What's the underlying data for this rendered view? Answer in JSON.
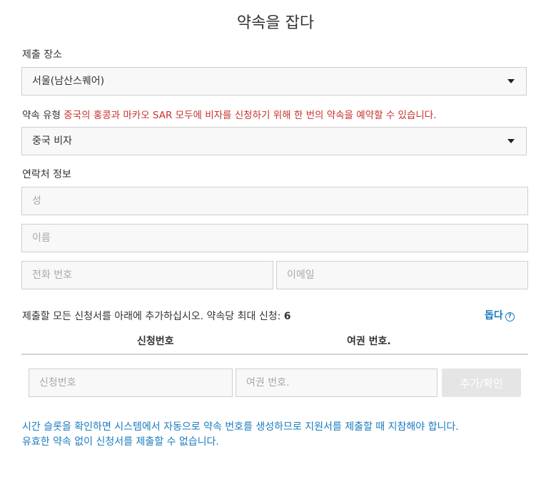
{
  "page_title": "약속을 잡다",
  "location": {
    "label": "제출 장소",
    "selected": "서울(남산스퀘어)"
  },
  "appointment_type": {
    "label": "약속 유형",
    "notice": "중국의 홍콩과 마카오 SAR 모두에 비자를 신청하기 위해 한 번의 약속을 예약할 수 있습니다.",
    "selected": "중국 비자"
  },
  "contact": {
    "label": "연락처 정보",
    "last_name_placeholder": "성",
    "first_name_placeholder": "이름",
    "phone_placeholder": "전화 번호",
    "email_placeholder": "이메일"
  },
  "applications": {
    "instruction": "제출할 모든 신청서를 아래에 추가하십시오. 약속당 최대 신청: ",
    "max_count": "6",
    "help_label": "돕다",
    "help_icon": "question-circle-icon",
    "col_application_no": "신청번호",
    "col_passport_no": "여권 번호.",
    "application_no_placeholder": "신청번호",
    "passport_no_placeholder": "여권 번호.",
    "add_button": "추가/확인"
  },
  "footer": {
    "line1": "시간 슬롯을 확인하면 시스템에서 자동으로 약속 번호를 생성하므로 지원서를 제출할 때 지참해야 합니다.",
    "line2": "유효한 약속 없이 신청서를 제출할 수 없습니다."
  },
  "colors": {
    "accent": "#1a7bbf",
    "warning": "#c9302c",
    "field_bg": "#f8f8f8",
    "disabled_button": "#e5e5e5"
  }
}
